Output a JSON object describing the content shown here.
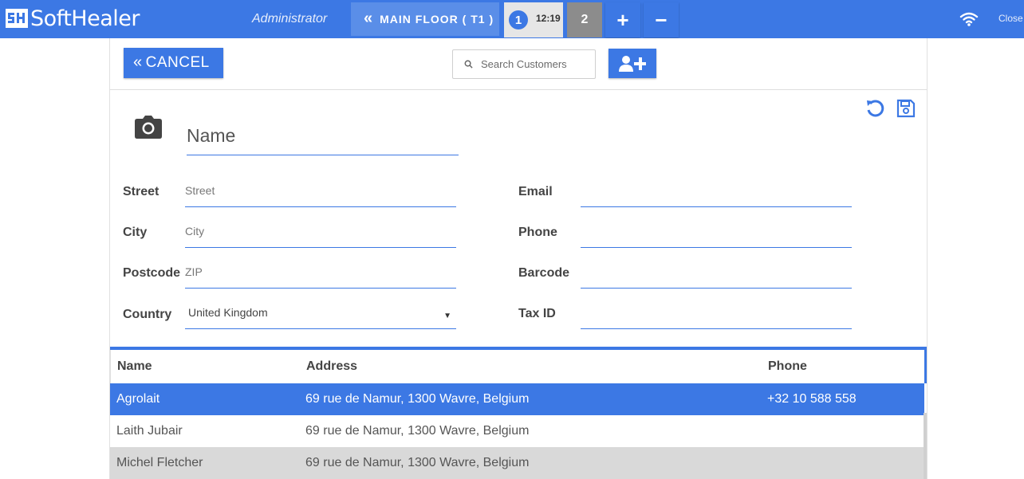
{
  "app": {
    "brand": "SoftHealer",
    "user": "Administrator",
    "close_label": "Close"
  },
  "header": {
    "floor_label": "MAIN FLOOR ( T1 )",
    "orders": [
      {
        "number": "1",
        "time": "12:19",
        "active": true
      },
      {
        "number": "2",
        "active": false
      }
    ],
    "add_order_symbol": "+",
    "remove_order_symbol": "−"
  },
  "toolbar": {
    "cancel_label": "CANCEL",
    "search_placeholder": "Search Customers"
  },
  "form": {
    "name_placeholder": "Name",
    "labels": {
      "street": "Street",
      "city": "City",
      "postcode": "Postcode",
      "country": "Country",
      "email": "Email",
      "phone": "Phone",
      "barcode": "Barcode",
      "tax_id": "Tax ID"
    },
    "placeholders": {
      "street": "Street",
      "city": "City",
      "postcode": "ZIP"
    },
    "country_value": "United Kingdom",
    "email": "",
    "phone": "",
    "barcode": "",
    "tax_id": ""
  },
  "customer_list": {
    "columns": {
      "name": "Name",
      "address": "Address",
      "phone": "Phone"
    },
    "rows": [
      {
        "name": "Agrolait",
        "address": "69 rue de Namur, 1300 Wavre, Belgium",
        "phone": "+32 10 588 558",
        "selected": true
      },
      {
        "name": "Laith Jubair",
        "address": "69 rue de Namur, 1300 Wavre, Belgium",
        "phone": ""
      },
      {
        "name": "Michel Fletcher",
        "address": "69 rue de Namur, 1300 Wavre, Belgium",
        "phone": ""
      }
    ]
  },
  "colors": {
    "primary": "#3c78e4",
    "row_alt": "#d9d9d9",
    "tab_inactive": "#8c8c8c"
  }
}
